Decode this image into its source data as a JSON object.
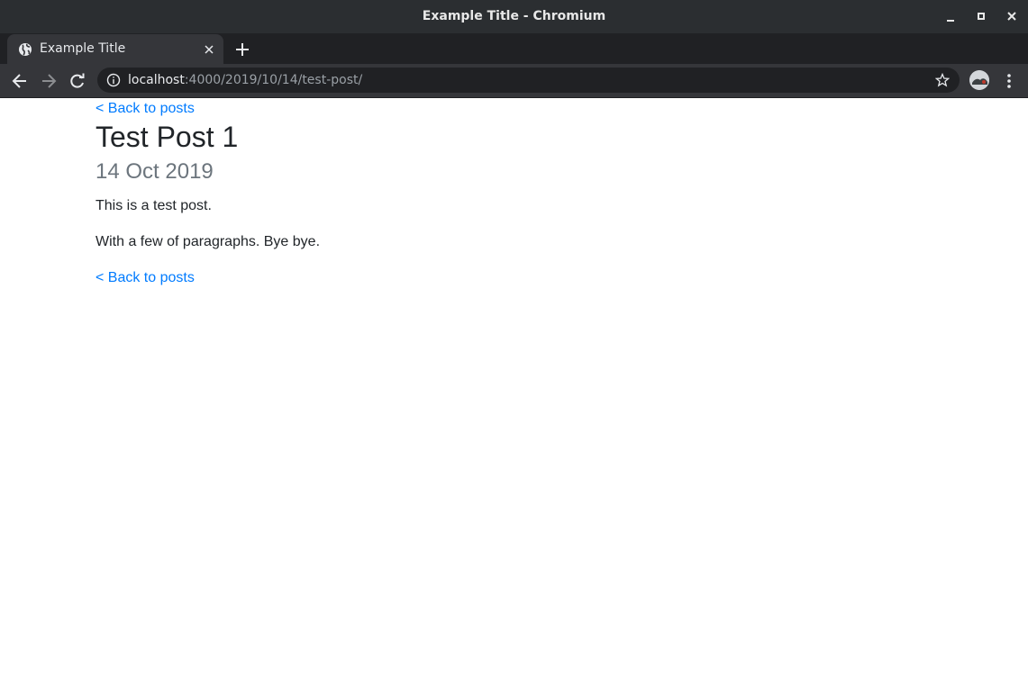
{
  "window": {
    "title": "Example Title - Chromium"
  },
  "tab": {
    "title": "Example Title"
  },
  "address_bar": {
    "host": "localhost",
    "path": ":4000/2019/10/14/test-post/"
  },
  "post": {
    "back_link_top": "< Back to posts",
    "title": "Test Post 1",
    "date": "14 Oct 2019",
    "paragraphs": [
      "This is a test post.",
      "With a few of paragraphs. Bye bye."
    ],
    "back_link_bottom": "< Back to posts"
  },
  "colors": {
    "link": "#007bff",
    "text": "#212529",
    "muted": "#6c757d",
    "chrome_dark": "#202124",
    "chrome_toolbar": "#35363a"
  }
}
